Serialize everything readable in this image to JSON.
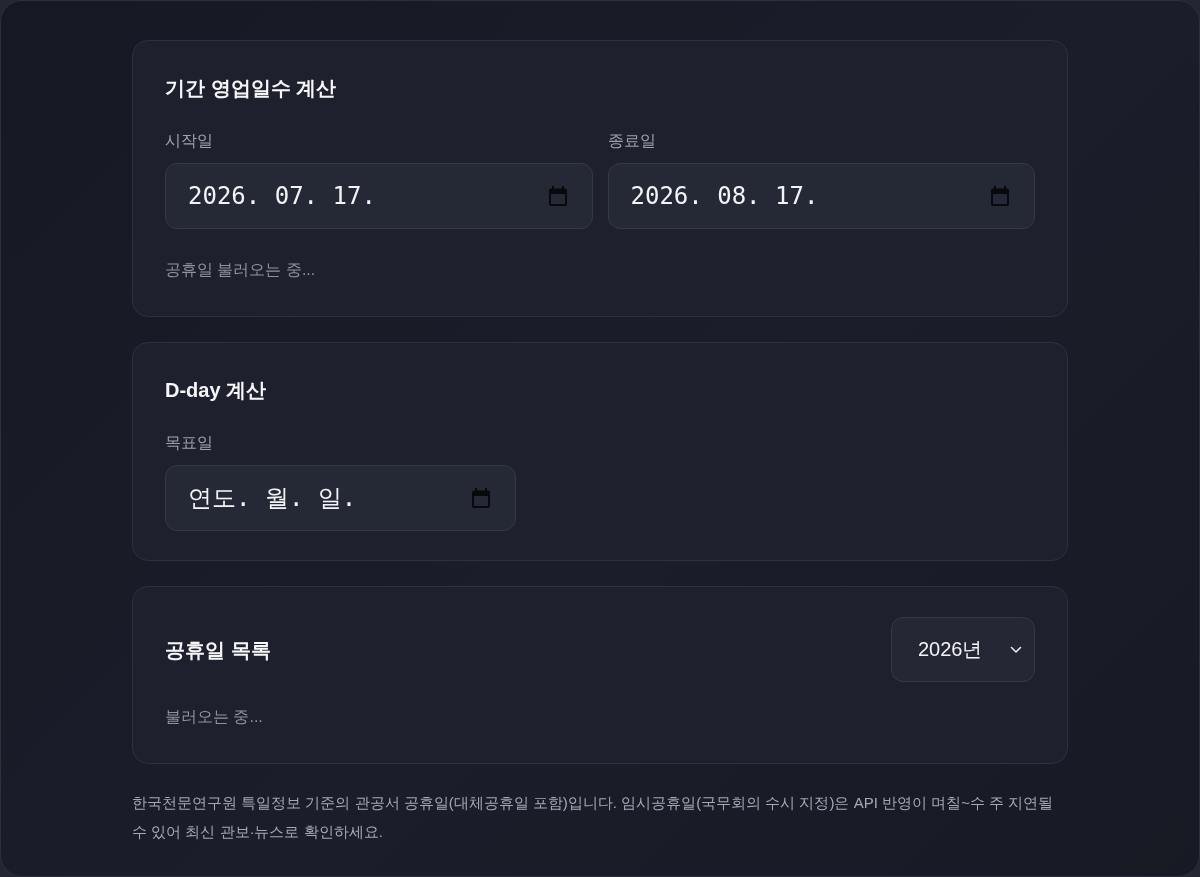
{
  "cards": [
    {
      "title": "기간 영업일수 계산",
      "fields": [
        {
          "label": "시작일",
          "value": "2026. 07. 17."
        },
        {
          "label": "종료일",
          "value": "2026. 08. 17."
        }
      ],
      "status": "공휴일 불러오는 중..."
    },
    {
      "title": "D-day 계산",
      "fields": [
        {
          "label": "목표일",
          "placeholder": "연도. 월. 일."
        }
      ]
    },
    {
      "title": "공휴일 목록",
      "year_select": {
        "value": "2026년"
      },
      "status": "불러오는 중..."
    }
  ],
  "footnote": "한국천문연구원 특일정보 기준의 관공서 공휴일(대체공휴일 포함)입니다. 임시공휴일(국무회의 수시 지정)은 API 반영이 며칠~수 주 지연될 수 있어 최신 관보·뉴스로 확인하세요."
}
